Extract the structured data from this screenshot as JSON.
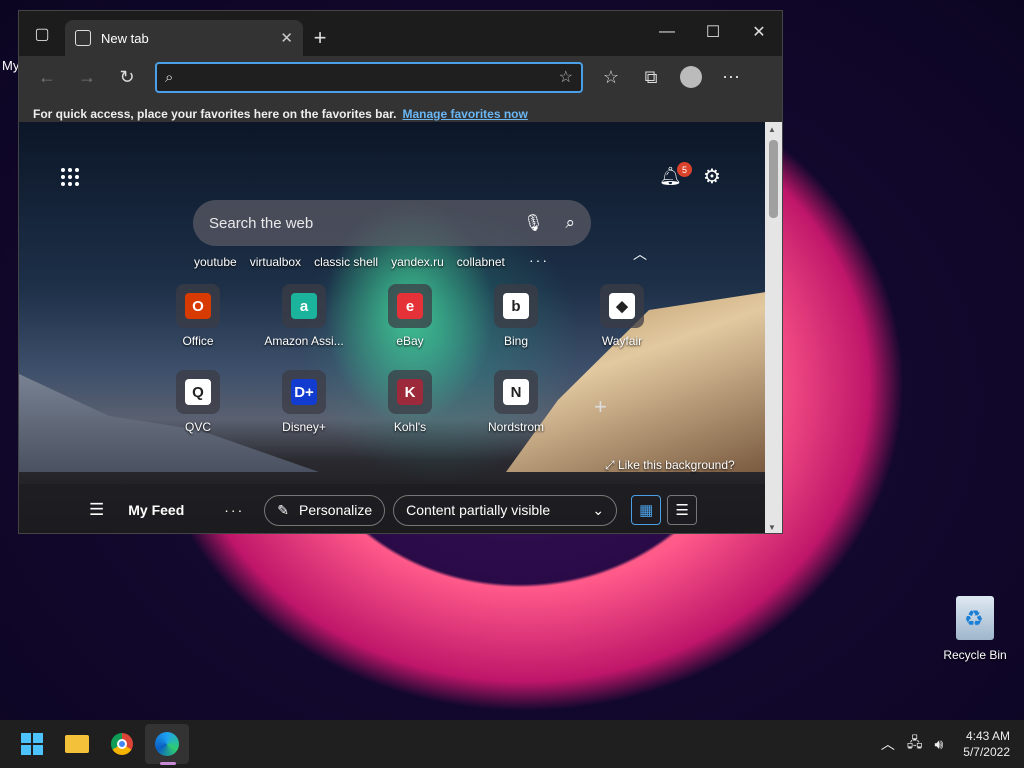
{
  "desktop": {
    "label": "My",
    "recycle_bin": "Recycle Bin"
  },
  "browser": {
    "tab": {
      "title": "New tab"
    },
    "address": {
      "value": "",
      "placeholder": ""
    },
    "favorites_bar": {
      "text": "For quick access, place your favorites here on the favorites bar.",
      "link": "Manage favorites now"
    },
    "newtab_page": {
      "notification_count": "5",
      "search_placeholder": "Search the web",
      "quick_links": [
        "youtube",
        "virtualbox",
        "classic shell",
        "yandex.ru",
        "collabnet"
      ],
      "tiles": [
        {
          "name": "Office",
          "glyph": "O",
          "bg": "#d83b01"
        },
        {
          "name": "Amazon Assi...",
          "glyph": "a",
          "bg": "#1cb39c"
        },
        {
          "name": "eBay",
          "glyph": "e",
          "bg": "#e53238"
        },
        {
          "name": "Bing",
          "glyph": "b",
          "bg": "#ffffff"
        },
        {
          "name": "Wayfair",
          "glyph": "◆",
          "bg": "#ffffff"
        },
        {
          "name": "QVC",
          "glyph": "Q",
          "bg": "#ffffff"
        },
        {
          "name": "Disney+",
          "glyph": "D+",
          "bg": "#113ccf"
        },
        {
          "name": "Kohl's",
          "glyph": "K",
          "bg": "#9c2a3a"
        },
        {
          "name": "Nordstrom",
          "glyph": "N",
          "bg": "#ffffff"
        }
      ],
      "like_background": "Like this background?",
      "feed": {
        "title": "My Feed",
        "personalize": "Personalize",
        "content_visibility": "Content partially visible"
      }
    }
  },
  "taskbar": {
    "time": "4:43 AM",
    "date": "5/7/2022"
  },
  "colors": {
    "accent": "#4aa0e6",
    "badge": "#d9432b"
  }
}
